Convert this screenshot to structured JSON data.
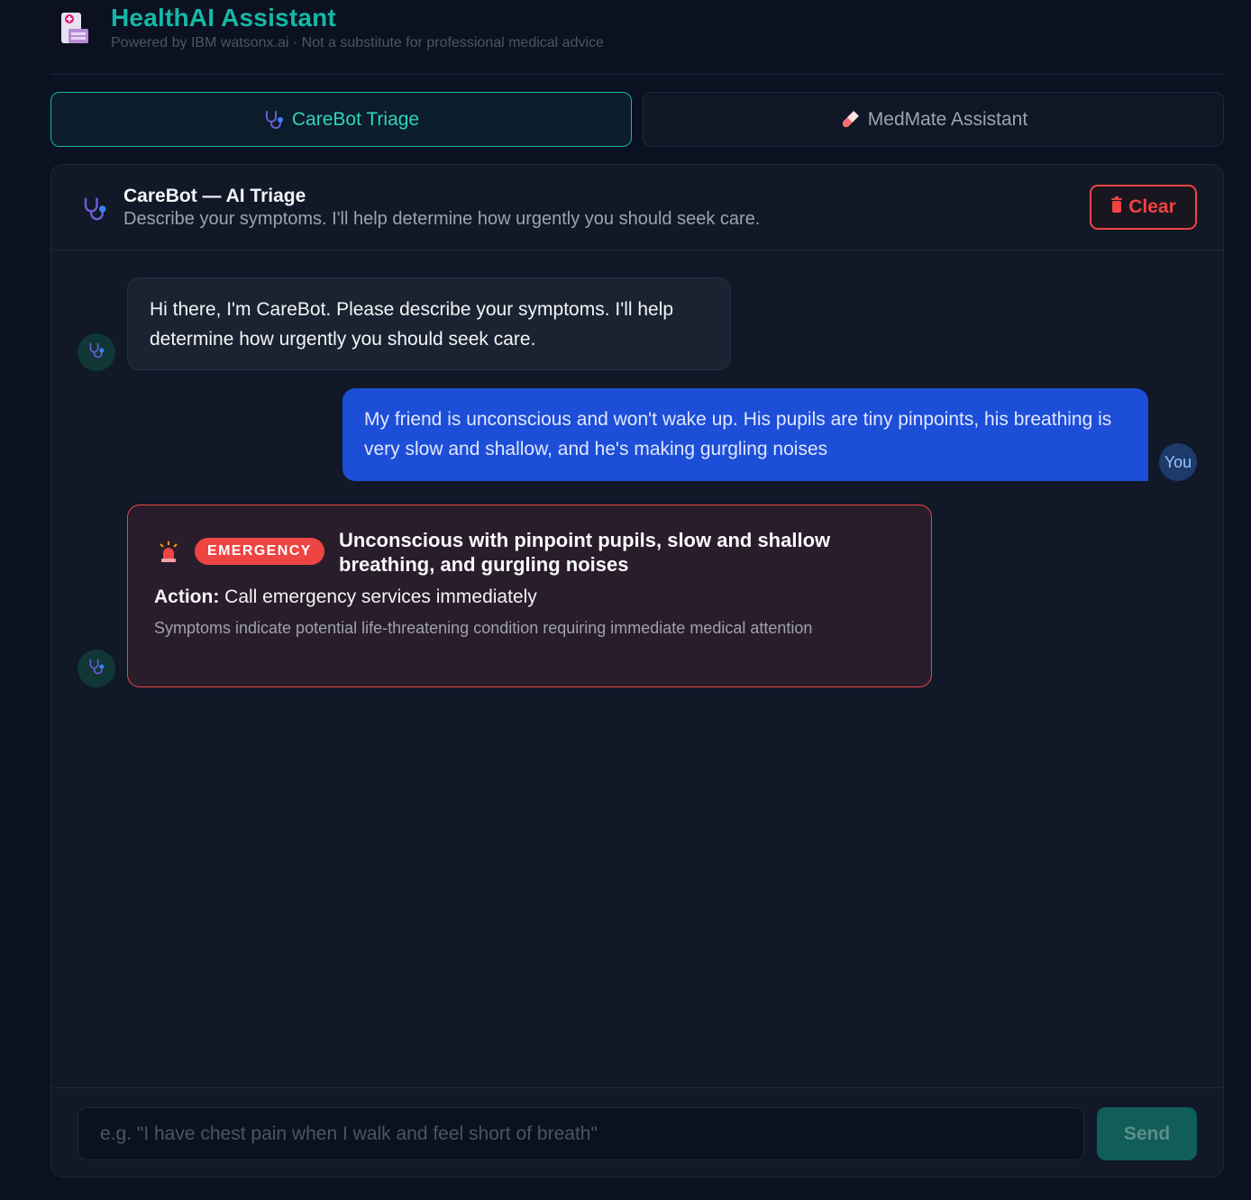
{
  "header": {
    "title": "HealthAI Assistant",
    "subtitle": "Powered by IBM watsonx.ai · Not a substitute for professional medical advice",
    "logo_icon": "hospital-icon"
  },
  "tabs": [
    {
      "label": "CareBot Triage",
      "icon": "stethoscope-icon",
      "active": true
    },
    {
      "label": "MedMate Assistant",
      "icon": "pill-icon",
      "active": false
    }
  ],
  "panel": {
    "title": "CareBot — AI Triage",
    "subtitle": "Describe your symptoms. I'll help determine how urgently you should seek care.",
    "clear_label": "Clear",
    "clear_icon": "trash-icon"
  },
  "messages": {
    "bot_greeting": "Hi there, I'm CareBot. Please describe your symptoms. I'll help determine how urgently you should seek care.",
    "user_message": "My friend is unconscious and won't wake up. His pupils are tiny pinpoints, his breathing is very slow and shallow, and he's making gurgling noises",
    "user_avatar": "You",
    "triage": {
      "icon": "siren-icon",
      "badge": "EMERGENCY",
      "title": "Unconscious with pinpoint pupils, slow and shallow breathing, and gurgling noises",
      "action_label": "Action:",
      "action_text": "Call emergency services immediately",
      "detail": "Symptoms indicate potential life-threatening condition requiring immediate medical attention"
    }
  },
  "composer": {
    "placeholder": "e.g. \"I have chest pain when I walk and feel short of breath\"",
    "value": "",
    "send_label": "Send"
  },
  "colors": {
    "background": "#0b1120",
    "accent": "#14b8a6",
    "user_bubble": "#1d4ed8",
    "emergency": "#ef4444"
  }
}
